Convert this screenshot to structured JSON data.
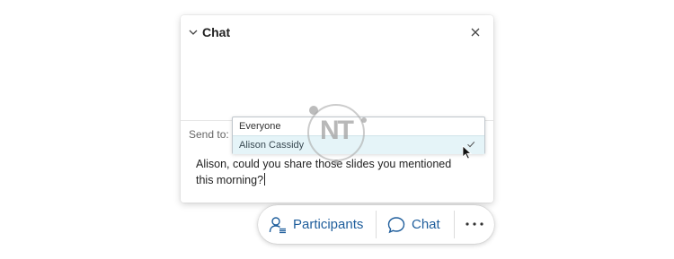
{
  "chat_panel": {
    "title": "Chat",
    "collapse_icon": "chevron-down-icon",
    "close_icon": "close-icon",
    "send_to_label": "Send to:",
    "message_text": "Alison, could you share those slides you mentioned this morning?"
  },
  "dropdown": {
    "options": [
      {
        "label": "Everyone",
        "selected": false
      },
      {
        "label": "Alison Cassidy",
        "selected": true
      }
    ],
    "check_icon": "checkmark-icon"
  },
  "watermark": {
    "text": "NT"
  },
  "toolbar": {
    "participants_label": "Participants",
    "participants_icon": "participants-icon",
    "chat_label": "Chat",
    "chat_icon": "chat-bubble-icon",
    "more_icon": "more-options-icon"
  },
  "colors": {
    "accent": "#1f5e9c",
    "selected_row": "#e5f4f8"
  }
}
